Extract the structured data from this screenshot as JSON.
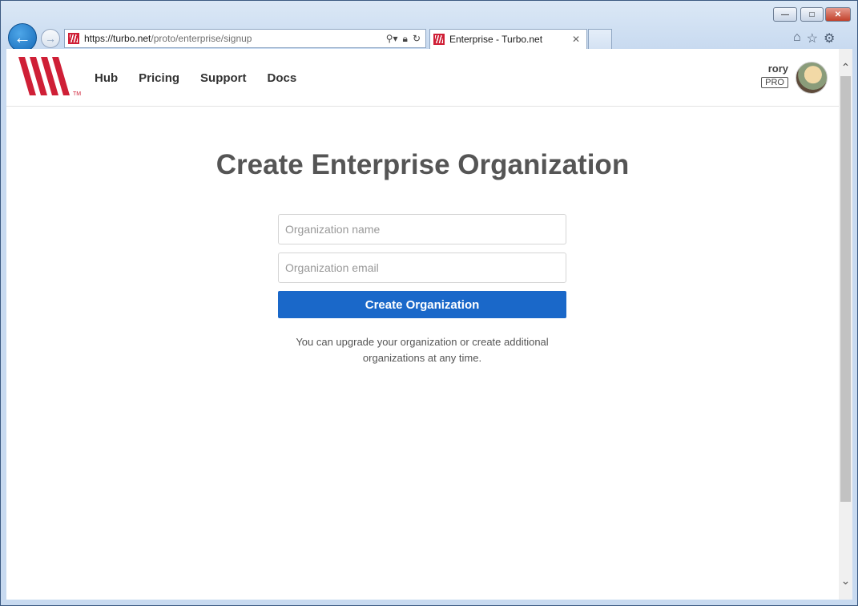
{
  "browser": {
    "window_controls": {
      "minimize": "—",
      "maximize": "□",
      "close": "✕"
    },
    "address": {
      "host": "https://turbo.net",
      "path": "/proto/enterprise/signup"
    },
    "tab": {
      "title": "Enterprise - Turbo.net",
      "close": "✕"
    },
    "icons": [
      "back-icon",
      "forward-icon",
      "search-icon",
      "lock-icon",
      "refresh-icon",
      "home-icon",
      "star-icon",
      "gear-icon"
    ]
  },
  "header": {
    "nav": [
      "Hub",
      "Pricing",
      "Support",
      "Docs"
    ],
    "user": {
      "name": "rory",
      "badge": "PRO"
    },
    "logo_mark": "TM"
  },
  "main": {
    "title": "Create Enterprise Organization",
    "org_name_placeholder": "Organization name",
    "org_email_placeholder": "Organization email",
    "submit_label": "Create Organization",
    "note_line1": "You can upgrade your organization or create additional",
    "note_line2": "organizations at any time."
  },
  "colors": {
    "brand_red": "#cf1f36",
    "primary_button": "#1a68c9"
  }
}
